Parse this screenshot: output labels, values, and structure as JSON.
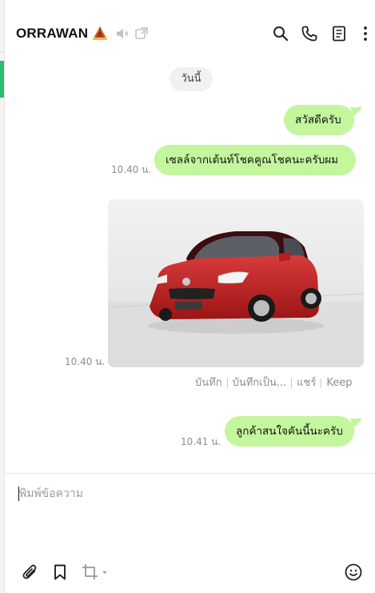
{
  "header": {
    "title": "ORRAWAN",
    "icons": [
      "leaf-emoji",
      "mute-icon",
      "popout-icon",
      "search-icon",
      "phone-icon",
      "notes-icon",
      "more-icon"
    ]
  },
  "chat": {
    "date_label": "วันนี้",
    "messages": [
      {
        "type": "text",
        "text": "สวัสดีครับ",
        "time": ""
      },
      {
        "type": "text",
        "text": "เซลล์จากเต้นท์โชคคูณโชคนะครับผม",
        "time": "10.40 น."
      },
      {
        "type": "image",
        "description": "red car",
        "time": "10.40 น."
      },
      {
        "type": "text",
        "text": "ลูกค้าสนใจคันนี้นะครับ",
        "time": "10.41 น."
      }
    ],
    "image_actions": [
      "บันทึก",
      "บันทึกเป็น...",
      "แชร์",
      "Keep"
    ]
  },
  "composer": {
    "placeholder": "พิมพ์ข้อความ",
    "tools": [
      "paperclip-icon",
      "bookmark-icon",
      "crop-icon",
      "emoji-icon"
    ]
  },
  "colors": {
    "bubble": "#c3f69d",
    "accent": "#2bbd6e"
  }
}
